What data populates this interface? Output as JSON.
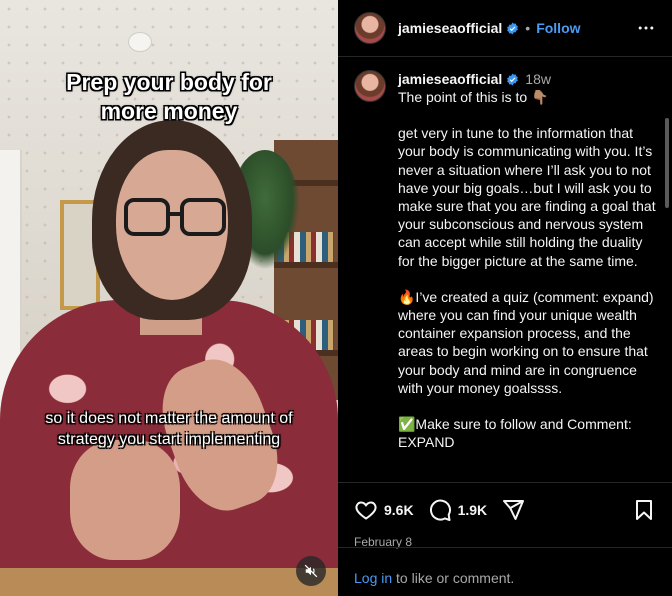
{
  "video": {
    "caption_top": "Prep your body for more money",
    "caption_bottom": "so it does not matter the amount of strategy you start implementing",
    "mute_icon": "speaker-muted-icon"
  },
  "header": {
    "username": "jamieseaofficial",
    "separator": "•",
    "follow_label": "Follow",
    "more_icon": "more-horizontal-icon"
  },
  "caption_comment": {
    "username": "jamieseaofficial",
    "time_ago": "18w",
    "paragraphs": [
      "The point of this is to 👇🏽",
      "get very in tune to the information that your body is communicating with you. It’s never a situation where I’ll ask you to not have your big goals…but I will ask you to make sure that you are finding a goal that your subconscious and nervous system can accept while still holding the duality for the bigger picture at the same time.",
      "🔥I’ve created a quiz (comment: expand) where you can find your unique wealth container expansion process, and the areas to begin working on to ensure that your body and mind are in congruence with your money goalssss.",
      "✅Make sure to follow and Comment: EXPAND"
    ]
  },
  "actions": {
    "likes": "9.6K",
    "comments": "1.9K",
    "date": "February 8"
  },
  "login_bar": {
    "link": "Log in",
    "rest": " to like or comment."
  },
  "colors": {
    "link_blue": "#4a9bf5",
    "background": "#000000",
    "muted_text": "#a8a8a8"
  }
}
